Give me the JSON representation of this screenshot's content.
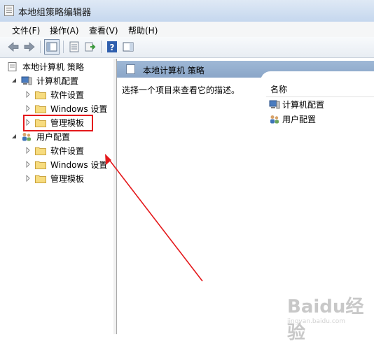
{
  "window": {
    "title": "本地组策略编辑器"
  },
  "menu": {
    "items": [
      "文件(F)",
      "操作(A)",
      "查看(V)",
      "帮助(H)"
    ]
  },
  "tree": {
    "root": "本地计算机 策略",
    "computer_config": "计算机配置",
    "user_config": "用户配置",
    "computer_children": [
      "软件设置",
      "Windows 设置",
      "管理模板"
    ],
    "user_children": [
      "软件设置",
      "Windows 设置",
      "管理模板"
    ]
  },
  "right": {
    "header_title": "本地计算机 策略",
    "description": "选择一个项目来查看它的描述。",
    "column_name": "名称",
    "items": [
      "计算机配置",
      "用户配置"
    ]
  },
  "annotation": {
    "box_color": "#e4181b",
    "arrow_color": "#e4181b"
  },
  "watermark": {
    "brand": "Baidu经验",
    "url": "jingyan.baidu.com"
  }
}
